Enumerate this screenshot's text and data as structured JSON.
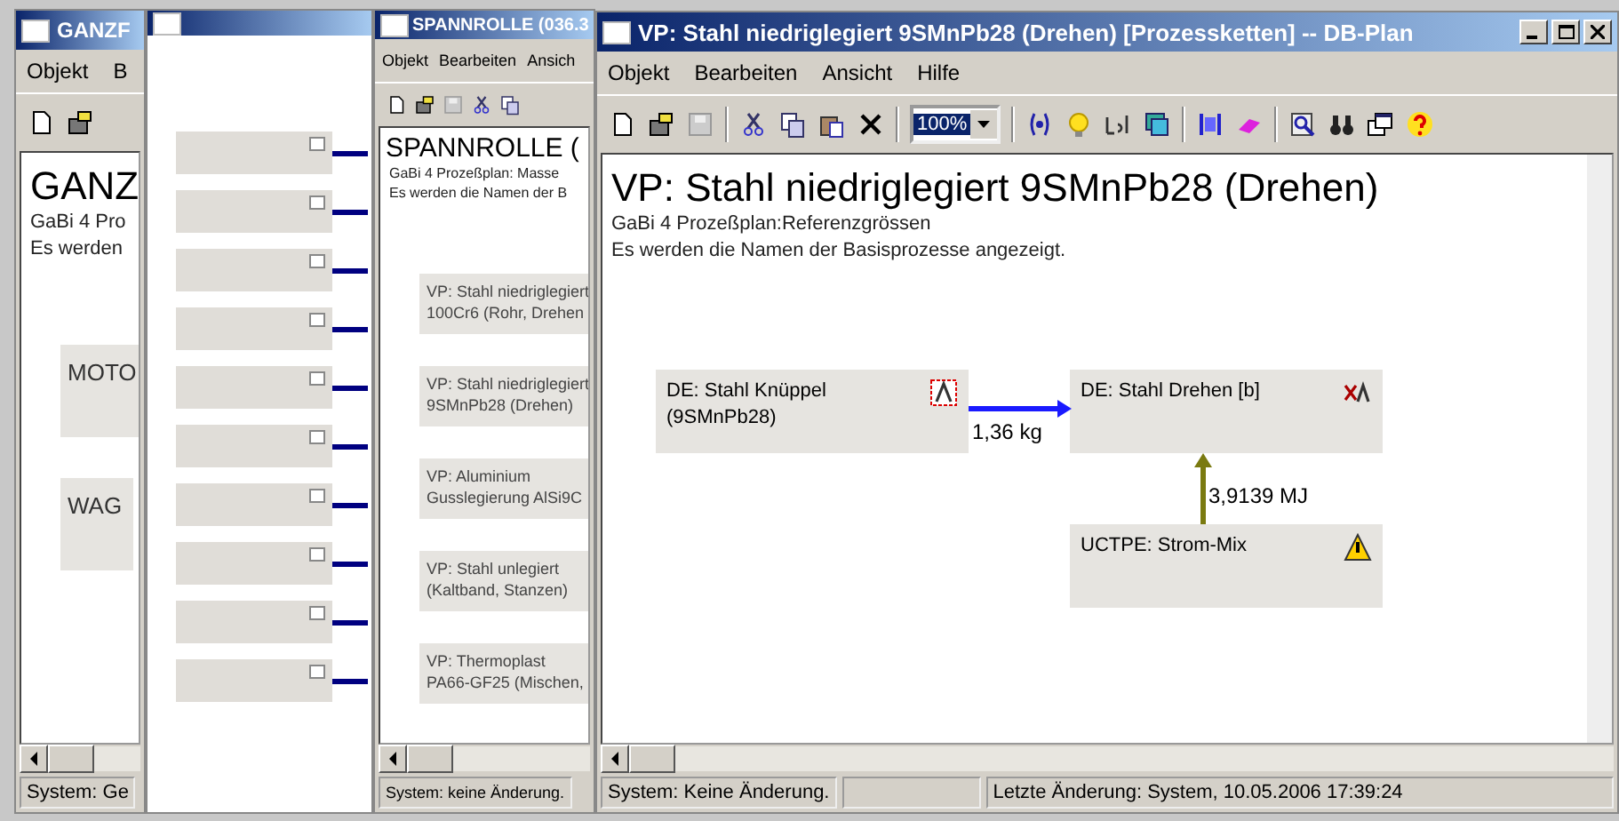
{
  "back_window_1": {
    "title": "GANZF",
    "menu": [
      "Objekt",
      "B"
    ],
    "heading": "GANZ",
    "lines": [
      "GaBi 4 Pro",
      "Es werden"
    ],
    "nodes": [
      {
        "label": "MOTO"
      },
      {
        "label": "WAG"
      }
    ],
    "status": "System: Ge"
  },
  "back_window_3": {
    "title": "SPANNROLLE (036.3",
    "menu": [
      "Objekt",
      "Bearbeiten",
      "Ansich"
    ],
    "heading": "SPANNROLLE (",
    "lines": [
      "GaBi 4 Prozeßplan: Masse",
      "Es werden die Namen der B"
    ],
    "nodes": [
      {
        "label": "VP: Stahl niedriglegiert 100Cr6 (Rohr, Drehen"
      },
      {
        "label": "VP: Stahl niedriglegiert 9SMnPb28 (Drehen)"
      },
      {
        "label": "VP: Aluminium Gusslegierung AlSi9C"
      },
      {
        "label": "VP: Stahl unlegiert (Kaltband, Stanzen)"
      },
      {
        "label": "VP: Thermoplast PA66-GF25 (Mischen,"
      }
    ],
    "status": "System: keine Änderung."
  },
  "main_window": {
    "title": "VP: Stahl niedriglegiert 9SMnPb28 (Drehen) [Prozessketten] -- DB-Plan",
    "menu": [
      "Objekt",
      "Bearbeiten",
      "Ansicht",
      "Hilfe"
    ],
    "zoom": "100%",
    "heading": "VP: Stahl niedriglegiert 9SMnPb28 (Drehen)",
    "lines": [
      "GaBi 4 Prozeßplan:Referenzgrössen",
      "Es werden die Namen der Basisprozesse angezeigt."
    ],
    "nodes": [
      {
        "label": "DE: Stahl Knüppel (9SMnPb28)",
        "kind": "process"
      },
      {
        "label": "DE: Stahl Drehen [b]",
        "kind": "crossed"
      },
      {
        "label": "UCTPE: Strom-Mix",
        "kind": "warning"
      }
    ],
    "flows": [
      {
        "label": "1,36 kg",
        "color": "#1a1aff"
      },
      {
        "label": "3,9139 MJ",
        "color": "#7a7a10"
      }
    ],
    "status": [
      "System: Keine Änderung.",
      "Letzte Änderung: System, 10.05.2006 17:39:24"
    ]
  }
}
